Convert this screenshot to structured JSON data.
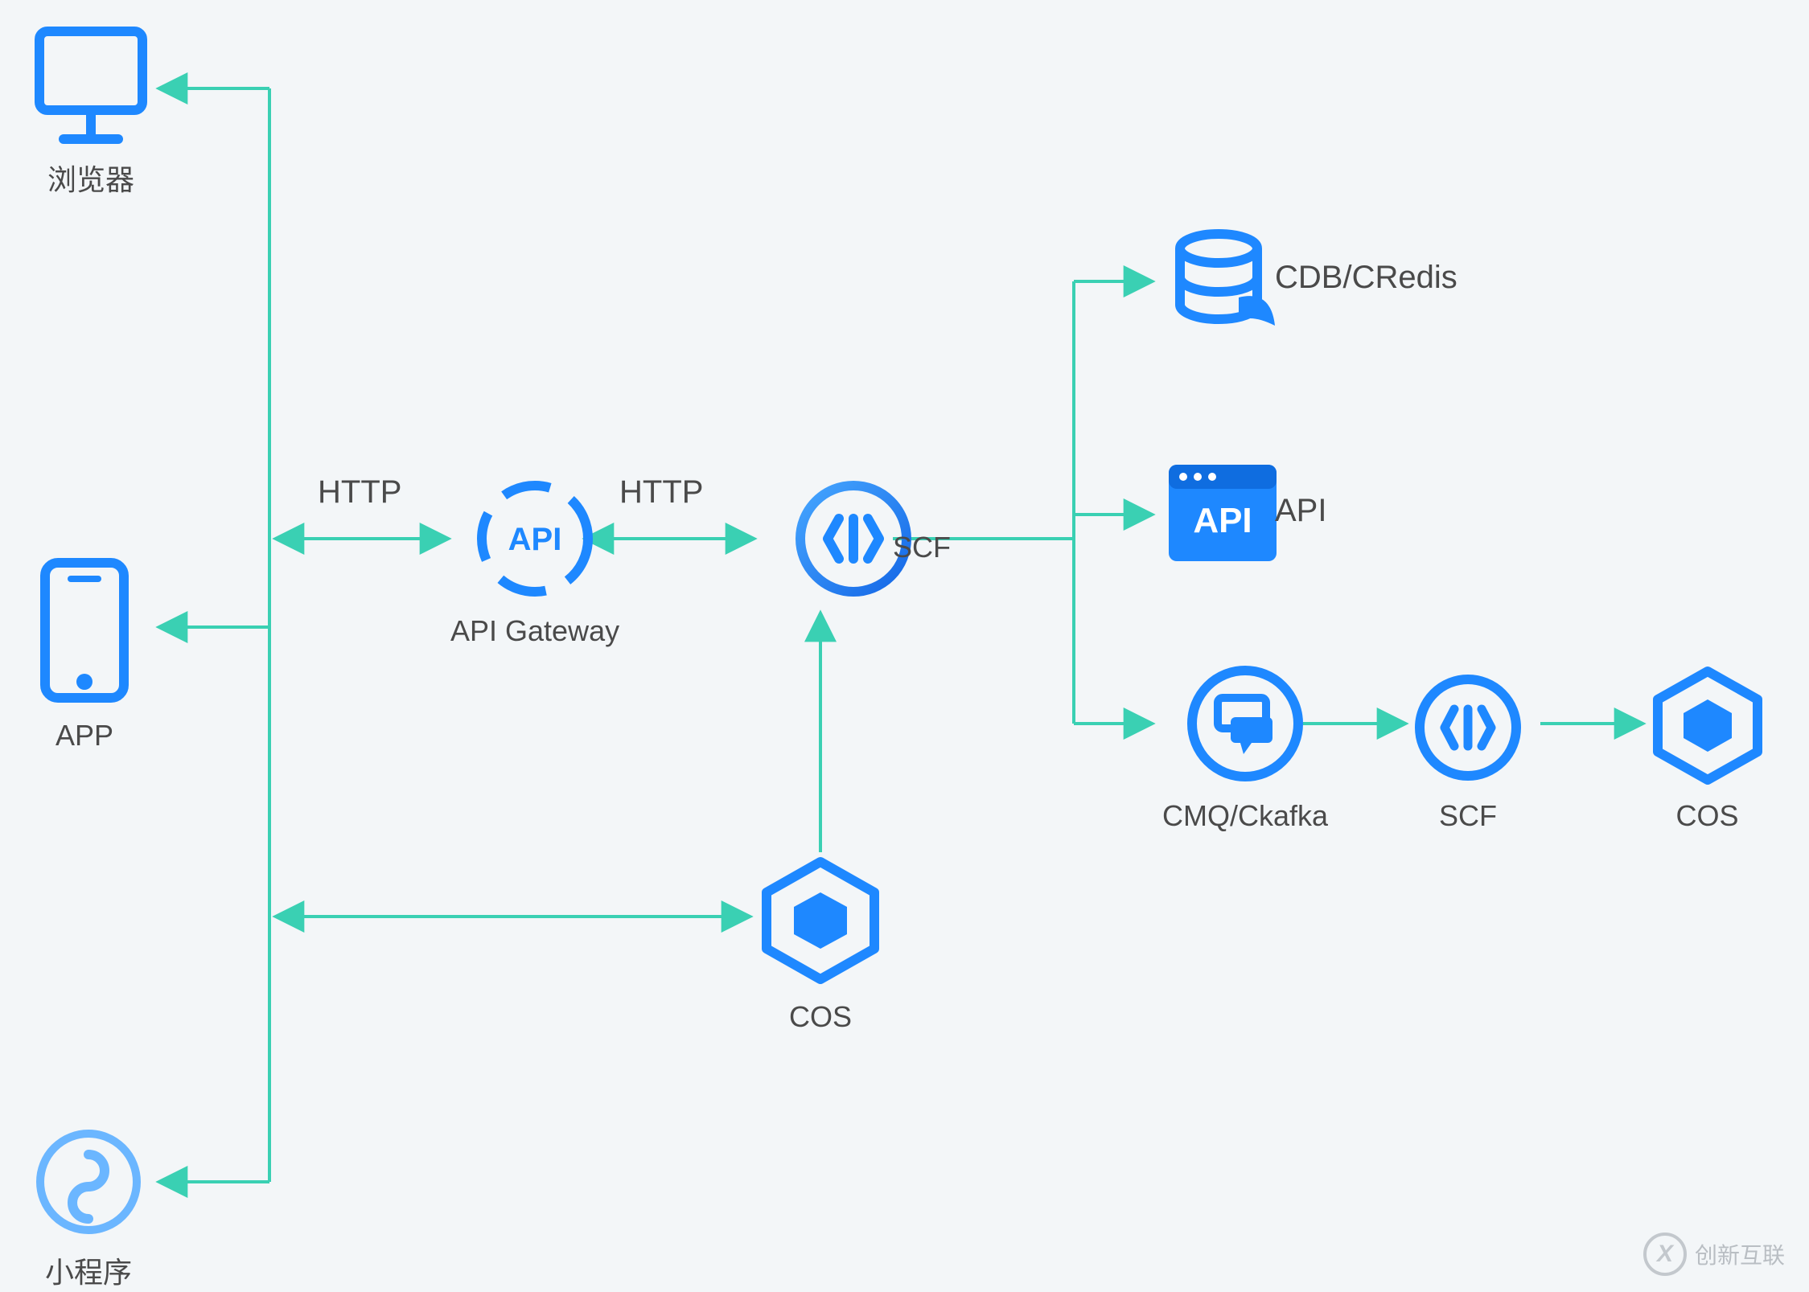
{
  "nodes": {
    "browser": {
      "label": "浏览器"
    },
    "app": {
      "label": "APP"
    },
    "miniprogram": {
      "label": "小程序"
    },
    "api_gateway": {
      "label": "API Gateway"
    },
    "scf_main": {
      "label": "SCF"
    },
    "cos_main": {
      "label": "COS"
    },
    "cdb_credis": {
      "label": "CDB/CRedis"
    },
    "api_box": {
      "label": "API"
    },
    "cmq_ckafka": {
      "label": "CMQ/Ckafka"
    },
    "scf2": {
      "label": "SCF"
    },
    "cos2": {
      "label": "COS"
    }
  },
  "edges": {
    "http1": "HTTP",
    "http2": "HTTP"
  },
  "colors": {
    "icon_blue": "#1e88ff",
    "arrow_teal": "#3ad0b3"
  },
  "watermark": {
    "text": "创新互联",
    "logo_letter": "X"
  }
}
